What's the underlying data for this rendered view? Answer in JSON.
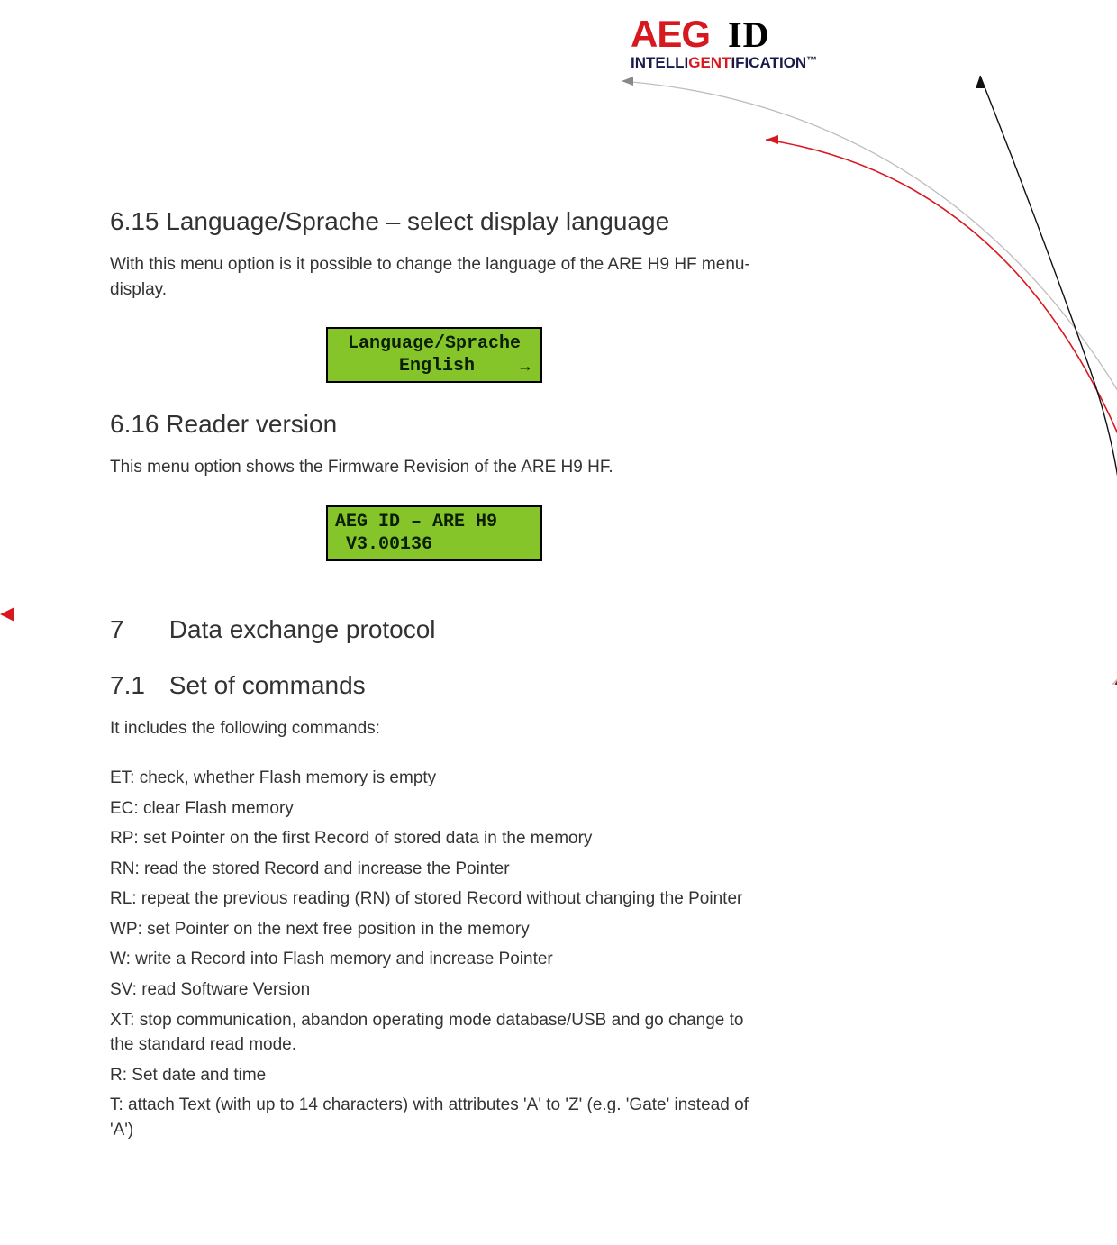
{
  "logo": {
    "brand1": "AEG",
    "brand2": "ID",
    "tag_pre": "INTELLI",
    "tag_mid": "GENT",
    "tag_post": "IFICATION",
    "tag_tm": "™"
  },
  "sections": {
    "s615_title": "6.15 Language/Sprache – select display language",
    "s615_para": "With this menu option is it possible to change the language of the ARE H9 HF menu-display.",
    "s615_lcd_line1": "Language/Sprache",
    "s615_lcd_line2_label": "English",
    "s615_lcd_arrow": "→",
    "s616_title": "6.16 Reader version",
    "s616_para": "This menu option shows the Firmware Revision of the ARE H9 HF.",
    "s616_lcd_line1": "AEG ID – ARE H9",
    "s616_lcd_line2": " V3.00136",
    "s7_num": "7",
    "s7_title": "Data exchange protocol",
    "s71_num": "7.1",
    "s71_title": "Set of commands",
    "s71_intro": "It includes the following commands:",
    "commands": [
      "ET: check, whether Flash memory is empty",
      "EC: clear Flash memory",
      "RP: set Pointer on the first Record of stored data in the memory",
      "RN: read the stored Record and increase the Pointer",
      "RL: repeat the previous reading (RN) of stored Record without changing the Pointer",
      "WP: set Pointer on the next free position in the memory",
      "W:   write a Record into Flash memory and increase Pointer",
      "SV: read Software Version",
      "XT: stop communication, abandon operating mode database/USB and go change to the standard read mode.",
      "R:       Set date and time",
      "T:       attach Text (with up to 14 characters) with attributes 'A' to 'Z' (e.g. 'Gate'  instead of 'A')"
    ]
  }
}
